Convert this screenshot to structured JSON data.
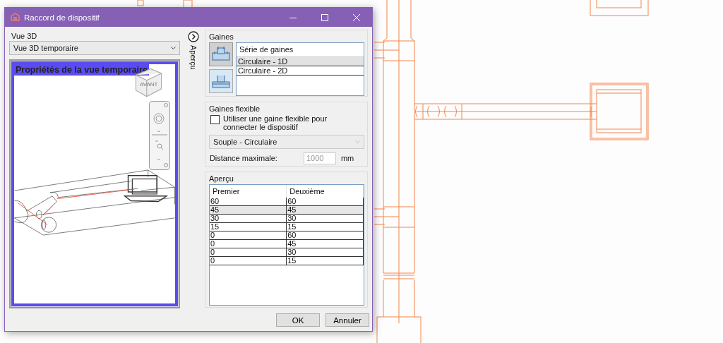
{
  "window": {
    "title": "Raccord de dispositif"
  },
  "view_3d": {
    "label": "Vue 3D",
    "dropdown": "Vue 3D temporaire",
    "viewport_title": "Propriétés de la vue temporaire",
    "viewcube_label": "AVANT"
  },
  "side_toggle": {
    "label": "Aperçu"
  },
  "ducts": {
    "label": "Gaines",
    "types": [
      {
        "selected": true
      },
      {
        "selected": false
      }
    ],
    "list": {
      "header": "Série de gaines",
      "items": [
        {
          "label": "Circulaire - 1D",
          "selected": true
        },
        {
          "label": "Circulaire - 2D",
          "selected": false
        }
      ]
    }
  },
  "flexible": {
    "label": "Gaines flexible",
    "checkbox": {
      "label": "Utiliser une gaine flexible pour connecter le dispositif",
      "checked": false
    },
    "type": {
      "value": "Souple - Circulaire",
      "disabled": true
    },
    "distance": {
      "label": "Distance maximale:",
      "value": "1000",
      "unit": "mm",
      "disabled": true
    }
  },
  "preview": {
    "label": "Aperçu",
    "columns": [
      "Premier",
      "Deuxième"
    ],
    "rows": [
      {
        "cells": [
          "60",
          "60"
        ],
        "selected": false
      },
      {
        "cells": [
          "45",
          "45"
        ],
        "selected": true
      },
      {
        "cells": [
          "30",
          "30"
        ],
        "selected": false
      },
      {
        "cells": [
          "15",
          "15"
        ],
        "selected": false
      },
      {
        "cells": [
          "0",
          "60"
        ],
        "selected": false
      },
      {
        "cells": [
          "0",
          "45"
        ],
        "selected": false
      },
      {
        "cells": [
          "0",
          "30"
        ],
        "selected": false
      },
      {
        "cells": [
          "0",
          "15"
        ],
        "selected": false
      }
    ]
  },
  "buttons": [
    "OK",
    "Annuler"
  ]
}
